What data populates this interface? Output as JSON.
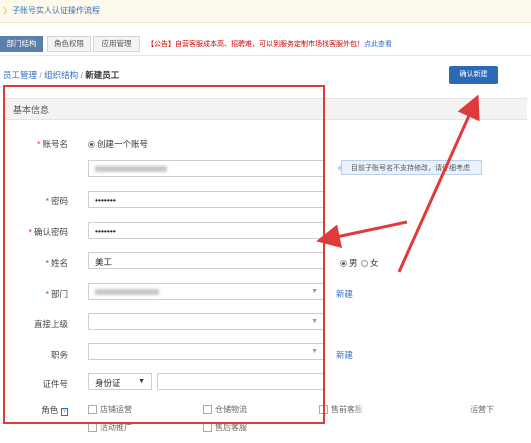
{
  "topbar": {
    "arrow": "〉",
    "text": "子账号实人认证操作流程"
  },
  "tabs": [
    {
      "label": "部门结构",
      "active": true
    },
    {
      "label": "角色权限",
      "active": false
    },
    {
      "label": "应用管理",
      "active": false
    }
  ],
  "notice": {
    "text": "【公告】自营客服成本高、招聘难，可以到服务定制市场找客服外包！",
    "link": "点此查看"
  },
  "breadcrumb": {
    "item1": "员工管理",
    "sep1": " / ",
    "item2": "组织结构",
    "sep2": " / ",
    "current": "新建员工"
  },
  "confirm_button": "确认新建",
  "section_title": "基本信息",
  "form": {
    "account_label": "账号名",
    "account_option": "创建一个账号",
    "account_tip": "目前子账号名不支持修改，请仔细考虑",
    "password_label": "密码",
    "password_value": "•••••••",
    "confirm_password_label": "确认密码",
    "confirm_password_value": "•••••••",
    "name_label": "姓名",
    "name_value": "美工",
    "gender_male": "男",
    "gender_female": "女",
    "department_label": "部门",
    "department_new": "新建",
    "supervisor_label": "直接上级",
    "position_label": "职务",
    "position_new": "新建",
    "id_label": "证件号",
    "id_type": "身份证",
    "role_label": "角色",
    "role_help": "?",
    "roles": [
      "店铺运营",
      "仓储物流",
      "售前客服",
      "活动推广",
      "售后客服",
      "运营下"
    ]
  },
  "colors": {
    "annotation_red": "#e03a3a",
    "primary_blue": "#2b6bb5",
    "link_blue": "#2f6fbf"
  }
}
